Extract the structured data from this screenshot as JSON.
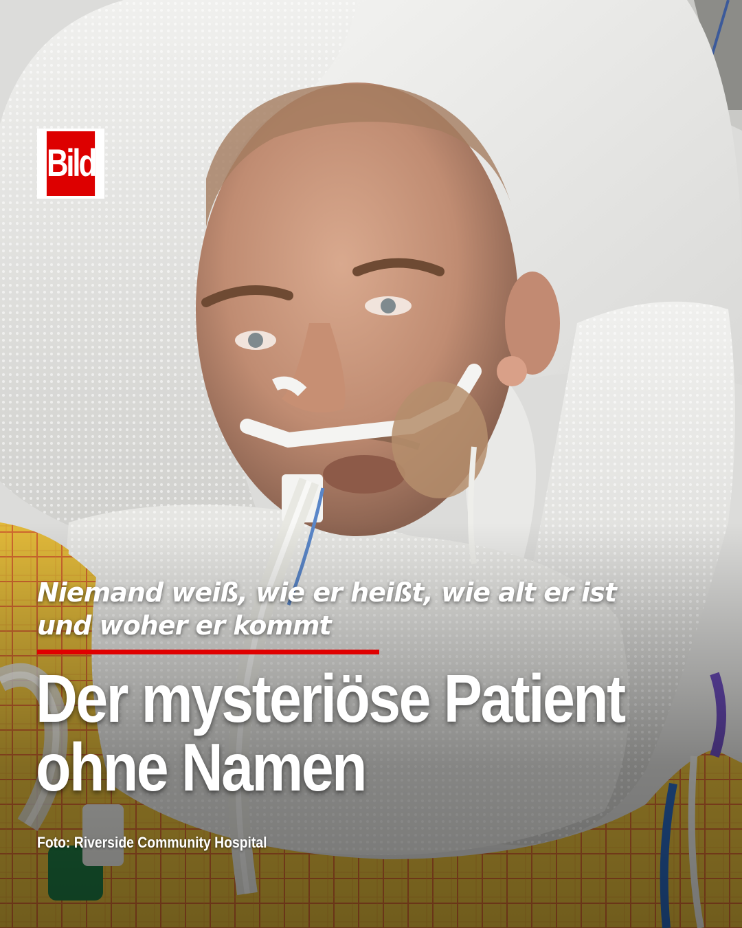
{
  "brand": {
    "logo_text": "Bild",
    "logo_color": "#dd0000"
  },
  "article": {
    "kicker": "Niemand weiß, wie er heißt, wie alt er ist und woher er kommt",
    "headline": "Der mysteriöse Patient ohne Namen",
    "photo_credit": "Foto: Riverside Community Hospital",
    "accent_color": "#e00000"
  }
}
